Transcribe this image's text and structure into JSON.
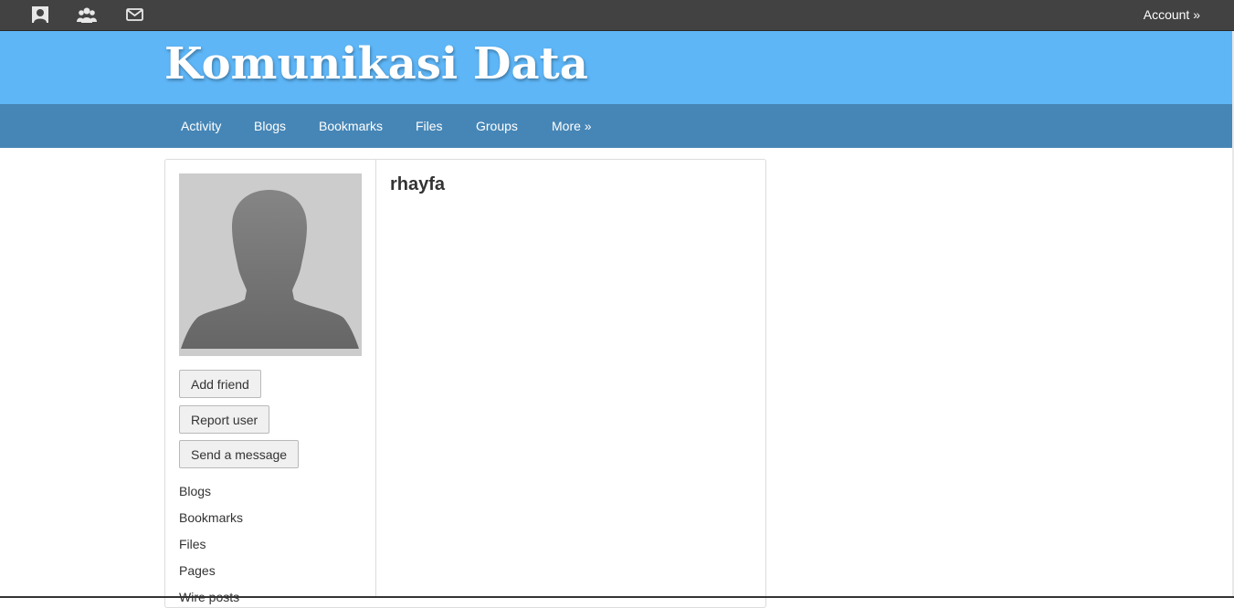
{
  "topbar": {
    "icons": [
      "profile-icon",
      "friends-icon",
      "messages-icon"
    ],
    "account_label": "Account »"
  },
  "site": {
    "title": "Komunikasi Data"
  },
  "nav": {
    "items": [
      {
        "label": "Activity"
      },
      {
        "label": "Blogs"
      },
      {
        "label": "Bookmarks"
      },
      {
        "label": "Files"
      },
      {
        "label": "Groups"
      },
      {
        "label": "More »"
      }
    ]
  },
  "profile": {
    "username": "rhayfa",
    "buttons": {
      "add_friend": "Add friend",
      "report_user": "Report user",
      "send_message": "Send a message"
    },
    "links": [
      {
        "label": "Blogs"
      },
      {
        "label": "Bookmarks"
      },
      {
        "label": "Files"
      },
      {
        "label": "Pages"
      },
      {
        "label": "Wire posts"
      }
    ]
  },
  "colors": {
    "topbar": "#424242",
    "banner": "#5eb6f7",
    "navbar": "#4686b6",
    "avatar_bg": "#cccccc",
    "avatar_silhouette": "#707070"
  }
}
